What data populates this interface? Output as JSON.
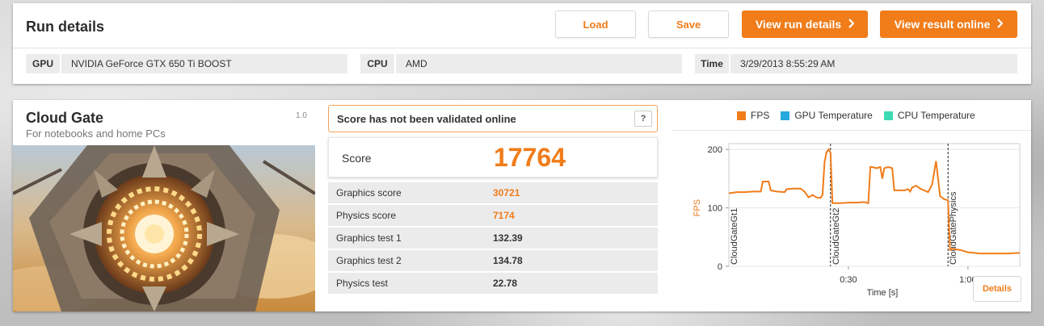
{
  "run": {
    "title": "Run details",
    "buttons": {
      "load": "Load",
      "save": "Save",
      "view_run_details": "View run details",
      "view_result_online": "View result online"
    },
    "fields": [
      {
        "label": "GPU",
        "value": "NVIDIA GeForce GTX 650 Ti BOOST"
      },
      {
        "label": "CPU",
        "value": "AMD"
      },
      {
        "label": "Time",
        "value": "3/29/2013 8:55:29 AM"
      }
    ]
  },
  "benchmark": {
    "title": "Cloud Gate",
    "subtitle": "For notebooks and home PCs",
    "version": "1.0"
  },
  "validation": {
    "message": "Score has not been validated online",
    "help": "?"
  },
  "score": {
    "label": "Score",
    "value": "17764"
  },
  "subscores": [
    {
      "label": "Graphics score",
      "value": "30721",
      "highlight": true
    },
    {
      "label": "Physics score",
      "value": "7174",
      "highlight": true
    },
    {
      "label": "Graphics test 1",
      "value": "132.39",
      "highlight": false
    },
    {
      "label": "Graphics test 2",
      "value": "134.78",
      "highlight": false
    },
    {
      "label": "Physics test",
      "value": "22.78",
      "highlight": false
    }
  ],
  "details_button": "Details",
  "colors": {
    "accent": "#f07c1a",
    "fps": "#f07c1a",
    "gpu_temp": "#29a8e0",
    "cpu_temp": "#3ddbb3"
  },
  "chart_data": {
    "type": "line",
    "legend": [
      "FPS",
      "GPU Temperature",
      "CPU Temperature"
    ],
    "legend_placement": "top",
    "xlabel": "Time [s]",
    "ylabel": "FPS",
    "xlim": [
      0,
      73
    ],
    "ylim": [
      0,
      210
    ],
    "yticks": [
      0,
      100,
      200
    ],
    "xticks": [
      {
        "value": 30,
        "label": "0:30"
      },
      {
        "value": 60,
        "label": "1:00"
      }
    ],
    "markers": [
      {
        "x": 0,
        "label": "CloudGateGt1"
      },
      {
        "x": 25.5,
        "label": "CloudGateGt2"
      },
      {
        "x": 55,
        "label": "CloudGatePhysics"
      }
    ],
    "series": [
      {
        "name": "FPS",
        "points": [
          [
            0,
            125
          ],
          [
            2,
            127
          ],
          [
            4,
            127
          ],
          [
            6,
            128
          ],
          [
            8,
            128
          ],
          [
            8.5,
            145
          ],
          [
            10,
            145
          ],
          [
            10.5,
            130
          ],
          [
            12,
            128
          ],
          [
            14,
            127
          ],
          [
            14.5,
            132
          ],
          [
            16,
            133
          ],
          [
            18,
            133
          ],
          [
            19,
            128
          ],
          [
            20,
            118
          ],
          [
            21,
            122
          ],
          [
            22,
            118
          ],
          [
            23,
            117
          ],
          [
            23.5,
            122
          ],
          [
            24,
            178
          ],
          [
            24.5,
            195
          ],
          [
            25,
            200
          ],
          [
            25.5,
            195
          ],
          [
            26,
            108
          ],
          [
            28,
            108
          ],
          [
            30,
            109
          ],
          [
            32,
            109
          ],
          [
            34,
            110
          ],
          [
            35,
            108
          ],
          [
            35.5,
            170
          ],
          [
            36,
            170
          ],
          [
            37,
            168
          ],
          [
            38,
            170
          ],
          [
            38.5,
            150
          ],
          [
            39,
            168
          ],
          [
            40,
            170
          ],
          [
            41,
            168
          ],
          [
            41.5,
            130
          ],
          [
            42,
            130
          ],
          [
            44,
            130
          ],
          [
            45,
            132
          ],
          [
            45.5,
            128
          ],
          [
            46,
            135
          ],
          [
            47,
            138
          ],
          [
            48,
            133
          ],
          [
            49,
            130
          ],
          [
            50,
            127
          ],
          [
            51,
            140
          ],
          [
            52,
            180
          ],
          [
            52.5,
            150
          ],
          [
            53,
            120
          ],
          [
            54,
            115
          ],
          [
            55,
            113
          ],
          [
            55.5,
            28
          ],
          [
            56,
            30
          ],
          [
            58,
            28
          ],
          [
            60,
            24
          ],
          [
            63,
            22
          ],
          [
            66,
            22
          ],
          [
            70,
            22
          ],
          [
            73,
            23
          ]
        ]
      }
    ]
  }
}
